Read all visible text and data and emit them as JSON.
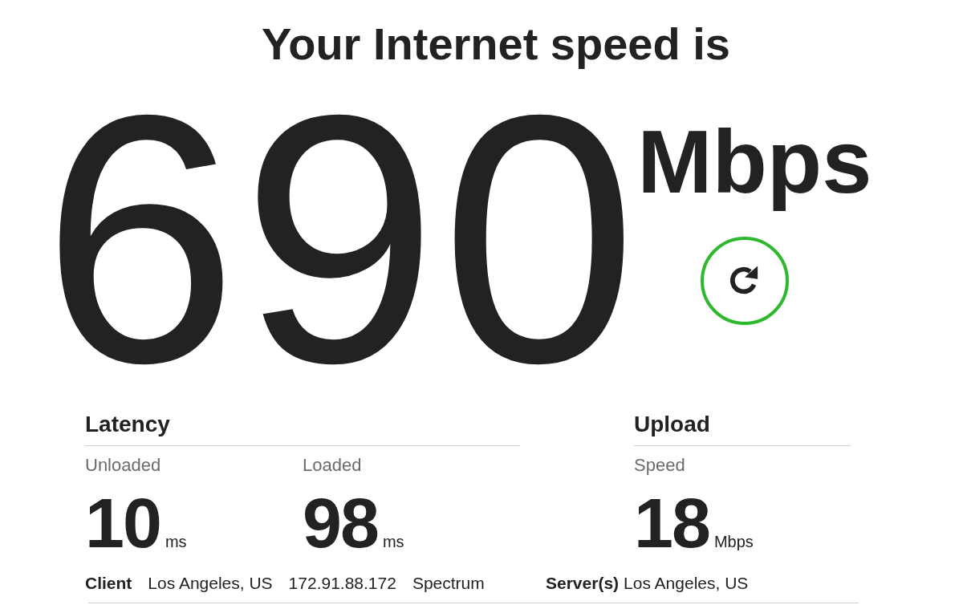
{
  "heading": "Your Internet speed is",
  "speed": {
    "value": "690",
    "unit": "Mbps"
  },
  "sections": [
    {
      "title": "Latency",
      "metrics": [
        {
          "label": "Unloaded",
          "value": "10",
          "unit": "ms"
        },
        {
          "label": "Loaded",
          "value": "98",
          "unit": "ms"
        }
      ]
    },
    {
      "title": "Upload",
      "metrics": [
        {
          "label": "Speed",
          "value": "18",
          "unit": "Mbps"
        }
      ]
    }
  ],
  "details": [
    {
      "label": "Client",
      "values": [
        "Los Angeles, US",
        "172.91.88.172",
        "Spectrum"
      ]
    },
    {
      "label": "Server(s)",
      "values": [
        "Los Angeles, US"
      ]
    }
  ]
}
